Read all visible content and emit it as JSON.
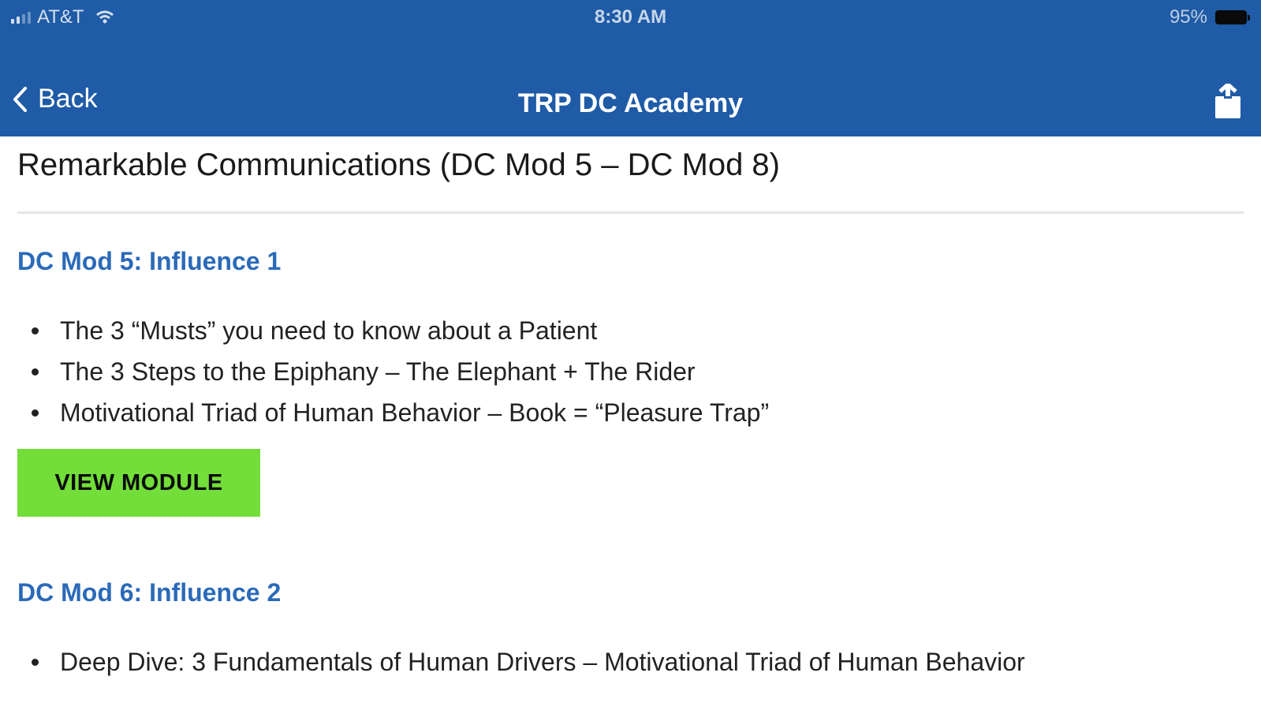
{
  "status_bar": {
    "carrier": "AT&T",
    "time": "8:30 AM",
    "battery": "95%"
  },
  "nav": {
    "back_label": "Back",
    "title": "TRP DC Academy"
  },
  "page": {
    "title": "Remarkable Communications (DC Mod 5 – DC Mod 8)"
  },
  "modules": [
    {
      "heading": "DC Mod 5: Influence 1",
      "topics": [
        "The 3 “Musts” you need to know about a Patient",
        "The 3 Steps to the Epiphany – The Elephant + The Rider",
        "Motivational Triad of Human Behavior – Book = “Pleasure Trap”"
      ],
      "button_label": "VIEW MODULE"
    },
    {
      "heading": "DC Mod 6: Influence 2",
      "topics": [
        "Deep Dive: 3 Fundamentals of Human Drivers – Motivational Triad of Human Behavior"
      ]
    }
  ],
  "colors": {
    "header_bg": "#1f5ba6",
    "module_heading": "#2b6ab8",
    "button_bg": "#73dd3a"
  },
  "icons": {
    "back": "chevron-left-icon",
    "share": "share-icon",
    "signal": "signal-icon",
    "wifi": "wifi-icon",
    "battery": "battery-icon"
  }
}
